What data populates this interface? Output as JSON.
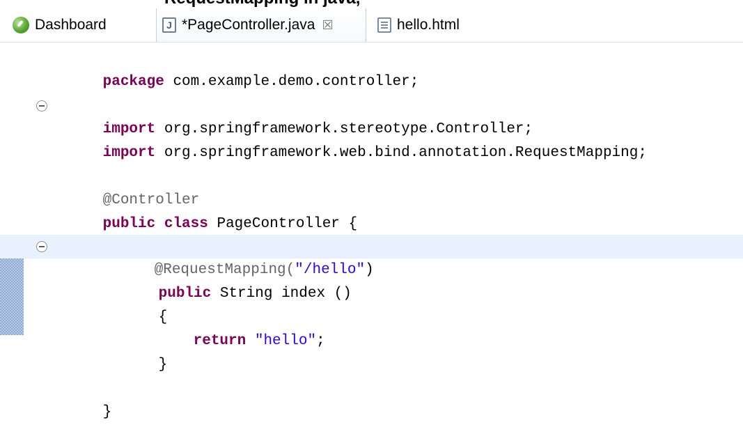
{
  "title_fragment": "RequestMapping in java,",
  "tabs": [
    {
      "label": "Dashboard",
      "icon": "dashboard-icon"
    },
    {
      "label": "*PageController.java",
      "icon": "java-file-icon",
      "close": "☒",
      "active": true
    },
    {
      "label": "hello.html",
      "icon": "html-file-icon"
    }
  ],
  "code": {
    "package_kw": "package",
    "package_name": " com.example.demo.controller;",
    "import_kw_1": "import",
    "import_1": " org.springframework.stereotype.Controller;",
    "import_kw_2": "import",
    "import_2": " org.springframework.web.bind.annotation.RequestMapping;",
    "annotation_controller": "@Controller",
    "public_kw": "public",
    "class_kw": " class",
    "class_name": " PageController {",
    "annotation_requestmapping": "@RequestMapping(",
    "mapping_value": "\"/hello\"",
    "mapping_close": ")",
    "method_public_kw": "public",
    "method_sig": " String index ()",
    "open_brace": "{",
    "return_kw": "return",
    "return_value": " \"hello\"",
    "return_semicolon": ";",
    "close_brace_method": "}",
    "close_brace_class": "}"
  },
  "colors": {
    "keyword": "#7f0055",
    "annotation": "#646464",
    "string": "#2a00ff",
    "current_line": "#e8f2fe"
  }
}
